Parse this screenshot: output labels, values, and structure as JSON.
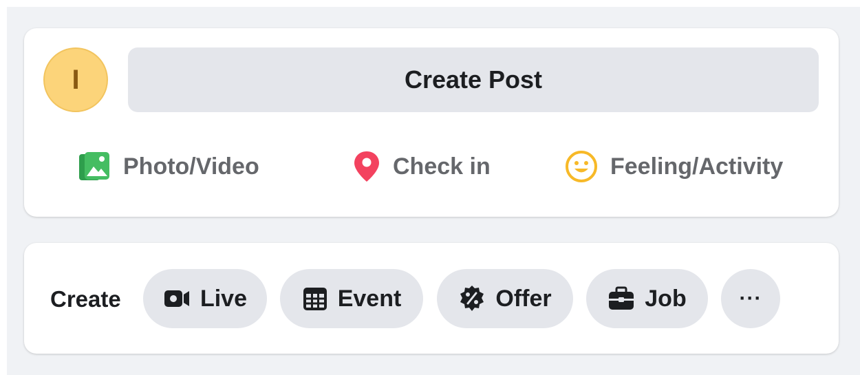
{
  "composer": {
    "avatar_initial": "I",
    "create_post_label": "Create Post",
    "actions": [
      {
        "label": "Photo/Video",
        "icon": "photo-video-icon",
        "color": "#45bd62"
      },
      {
        "label": "Check in",
        "icon": "location-pin-icon",
        "color": "#f3425f"
      },
      {
        "label": "Feeling/Activity",
        "icon": "smiley-icon",
        "color": "#f7b928"
      }
    ]
  },
  "create_bar": {
    "label": "Create",
    "buttons": [
      {
        "label": "Live",
        "icon": "video-camera-icon"
      },
      {
        "label": "Event",
        "icon": "calendar-icon"
      },
      {
        "label": "Offer",
        "icon": "offer-badge-icon"
      },
      {
        "label": "Job",
        "icon": "briefcase-icon"
      },
      {
        "label": "···",
        "icon": "more-options-icon"
      }
    ]
  },
  "colors": {
    "page_bg": "#f0f2f5",
    "pill_bg": "#e4e6eb",
    "avatar_bg": "#fcd47a",
    "text_primary": "#1c1e21",
    "text_secondary": "#65676b"
  }
}
